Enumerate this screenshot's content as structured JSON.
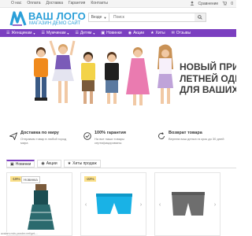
{
  "topnav": [
    "О нас",
    "Оплата",
    "Доставка",
    "Гарантия",
    "Контакты"
  ],
  "account": {
    "compare": "Сравнение",
    "cart_count": "0"
  },
  "logo": {
    "title": "ВАШ ЛОГО",
    "subtitle": "МАГАЗИН ДЕМО САЙТ"
  },
  "search": {
    "scope": "Везде",
    "placeholder": "Поиск"
  },
  "categories": [
    "Женщинам",
    "Мужчинам",
    "Детям",
    "Новинки",
    "Акции",
    "Хиты",
    "Отзывы"
  ],
  "banner": {
    "line1": "НОВЫЙ ПРИ",
    "line2": "ЛЕТНЕЙ ОДІ",
    "line3": "ДЛЯ ВАШИХ"
  },
  "features": [
    {
      "title": "Доставка по миру",
      "desc": "Отправим товар в любой город мира"
    },
    {
      "title": "100% гарантия",
      "desc": "На все наши товары сертифицированы"
    },
    {
      "title": "Возврат товара",
      "desc": "Вернем ваш деньги в срок до 30 дней"
    }
  ],
  "tabs": [
    "Новинки",
    "Акции",
    "Хиты продаж"
  ],
  "products": [
    {
      "sale": "-19%",
      "new": "Новинка"
    },
    {
      "sale": "-22%",
      "new": ""
    },
    {
      "sale": "",
      "new": ""
    }
  ],
  "footer_url": "avatars.mds.yandex.net/get-...",
  "colors": {
    "accent": "#7b3fc0",
    "logo": "#2a9fd8",
    "sale": "#fbe08a"
  }
}
